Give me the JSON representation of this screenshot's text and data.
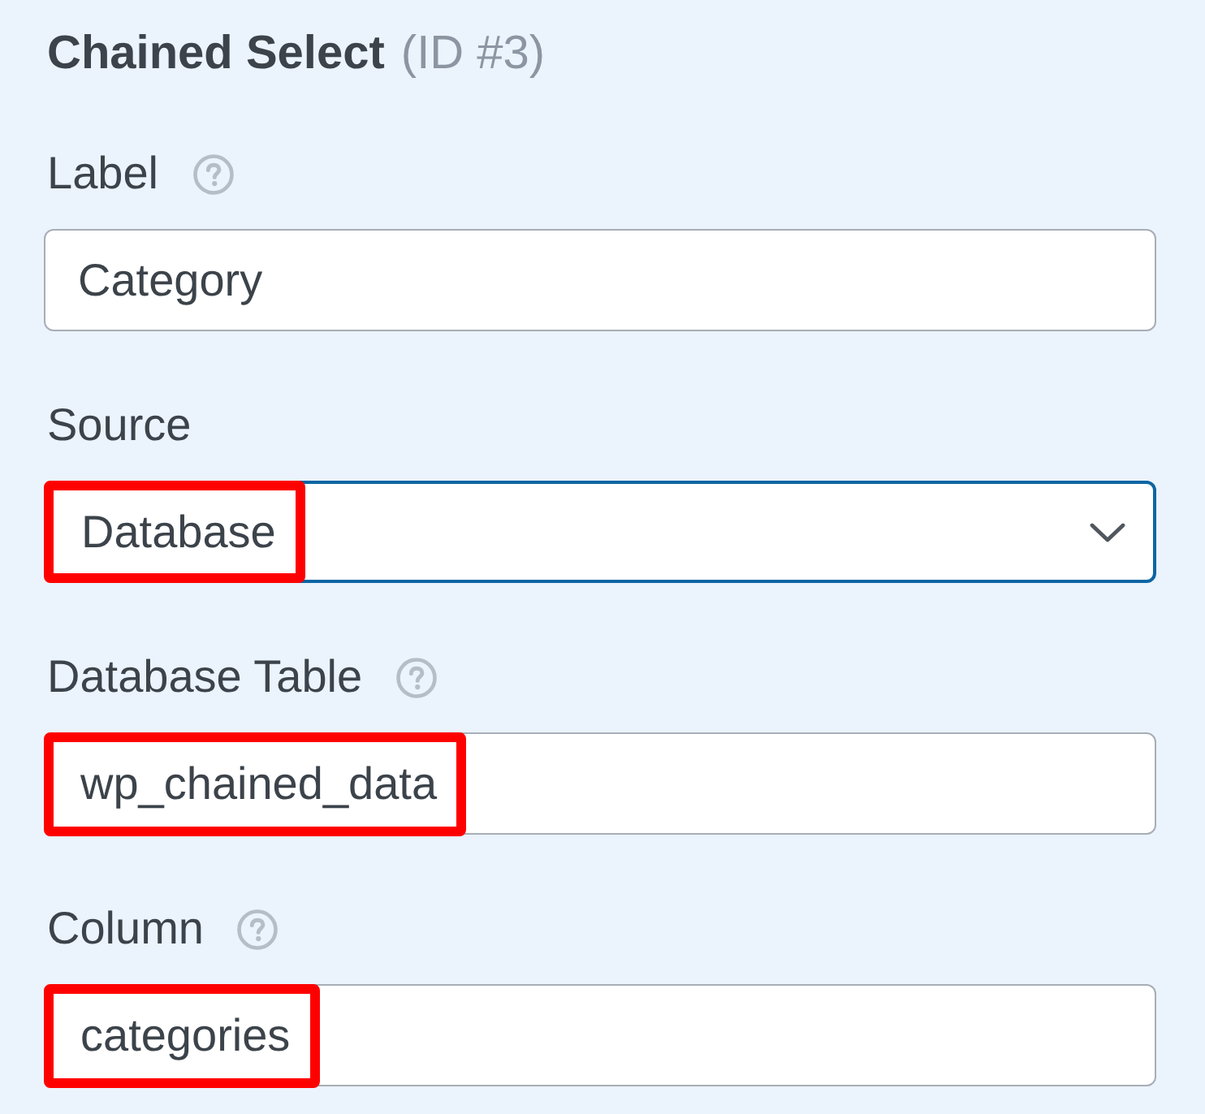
{
  "panel": {
    "title": "Chained Select",
    "id_label": "(ID #3)"
  },
  "fields": [
    {
      "kind": "text",
      "label": "Label",
      "help": true,
      "value": "Category",
      "highlighted": false,
      "focused": false
    },
    {
      "kind": "select",
      "label": "Source",
      "help": false,
      "value": "Database",
      "highlighted": true,
      "focused": true
    },
    {
      "kind": "text",
      "label": "Database Table",
      "help": true,
      "value": "wp_chained_data",
      "highlighted": true,
      "focused": false
    },
    {
      "kind": "text",
      "label": "Column",
      "help": true,
      "value": "categories",
      "highlighted": true,
      "focused": false
    }
  ]
}
